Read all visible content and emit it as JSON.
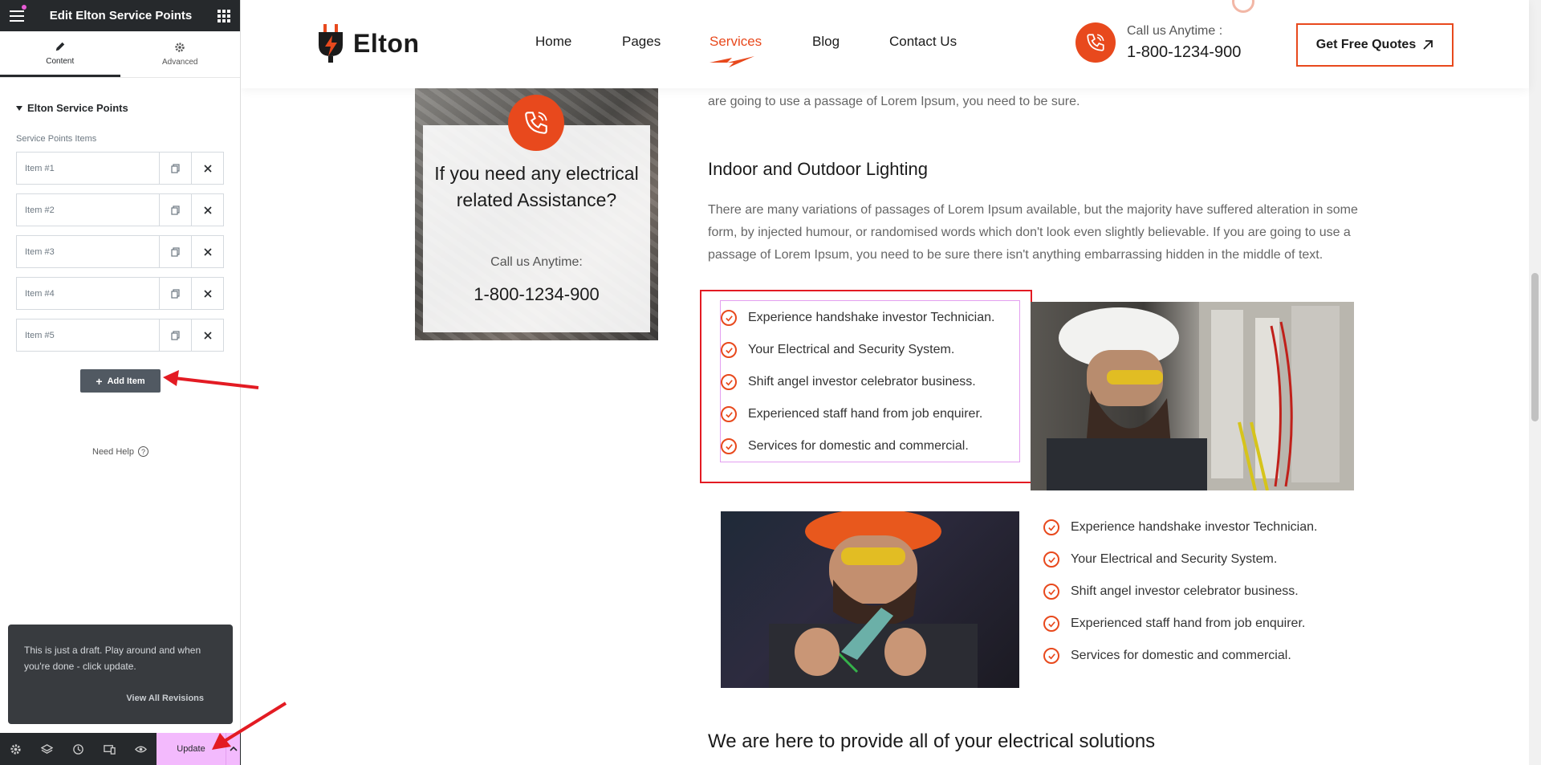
{
  "panel": {
    "title": "Edit Elton Service Points",
    "tabs": [
      {
        "label": "Content",
        "icon": "pencil-icon"
      },
      {
        "label": "Advanced",
        "icon": "gear-icon"
      }
    ],
    "section_title": "Elton Service Points",
    "repeater_label": "Service Points Items",
    "items": [
      {
        "label": "Item #1"
      },
      {
        "label": "Item #2"
      },
      {
        "label": "Item #3"
      },
      {
        "label": "Item #4"
      },
      {
        "label": "Item #5"
      }
    ],
    "add_item_label": "Add Item",
    "need_help_label": "Need Help",
    "draft_message": "This is just a draft. Play around and when you're done - click update.",
    "view_revisions_label": "View All Revisions",
    "footer_icons": [
      "settings-icon",
      "layers-icon",
      "history-icon",
      "responsive-icon",
      "preview-icon"
    ],
    "update_label": "Update"
  },
  "site": {
    "logo_text": "Elton",
    "nav": [
      "Home",
      "Pages",
      "Services",
      "Blog",
      "Contact Us"
    ],
    "active_nav": "Services",
    "call_label": "Call us Anytime :",
    "call_number": "1-800-1234-900",
    "quote_button": "Get Free Quotes",
    "help_card": {
      "heading": "If you need any electrical related Assistance?",
      "call_label": "Call us Anytime:",
      "number": "1-800-1234-900"
    },
    "para_top": "are going to use a passage of Lorem Ipsum, you need to be sure.",
    "heading_1": "Indoor and Outdoor Lighting",
    "para_1": "There are many variations of passages of Lorem Ipsum available, but the majority have suffered alteration in some form, by injected humour, or randomised words which don't look even slightly believable. If you are going to use a passage of Lorem Ipsum, you need to be sure there isn't anything embarrassing hidden in the middle of text.",
    "points": [
      "Experience handshake investor Technician.",
      "Your Electrical and Security System.",
      "Shift angel investor celebrator business.",
      "Experienced staff hand from job enquirer.",
      "Services for domestic and commercial."
    ],
    "heading_2": "We are here to provide all of your electrical solutions"
  },
  "colors": {
    "accent": "#e8491d",
    "selection": "#e31b23",
    "panel_dark": "#26292c",
    "update_bg": "#f3bafd"
  }
}
